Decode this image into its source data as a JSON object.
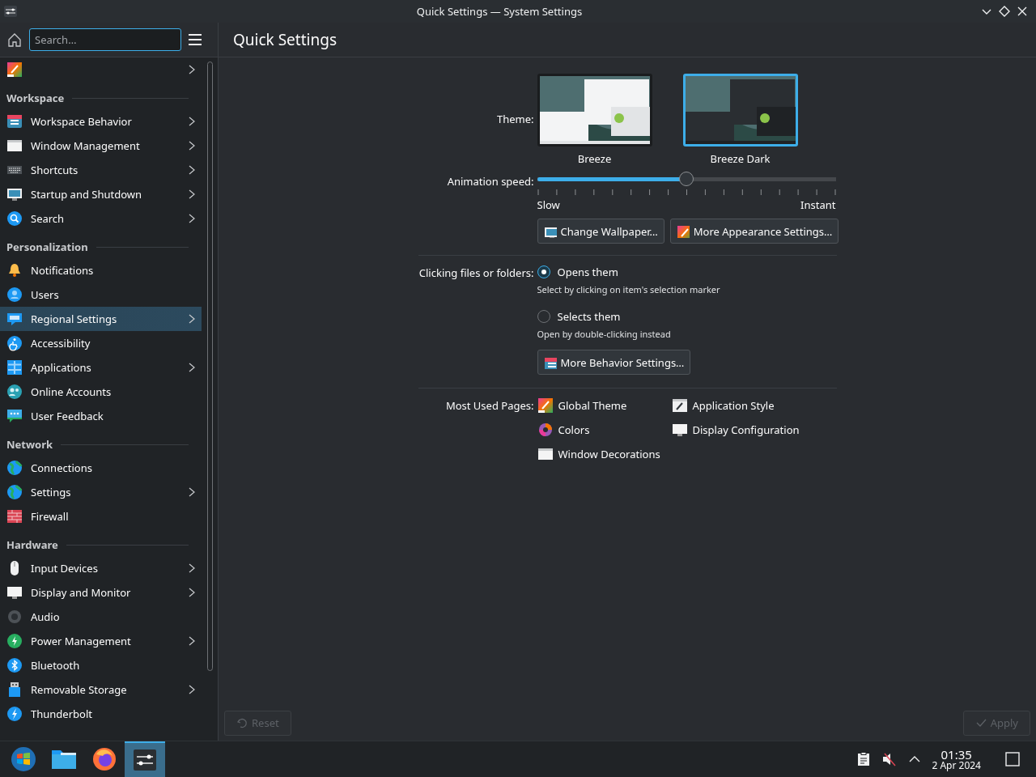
{
  "window": {
    "title": "Quick Settings — System Settings"
  },
  "search": {
    "placeholder": "Search…"
  },
  "page_title": "Quick Settings",
  "sidebar": {
    "top_item": {
      "has_children": true,
      "selected": false
    },
    "sections": [
      {
        "heading": "Workspace",
        "items": [
          {
            "label": "Workspace Behavior",
            "has_children": true,
            "selected": false
          },
          {
            "label": "Window Management",
            "has_children": true,
            "selected": false
          },
          {
            "label": "Shortcuts",
            "has_children": true,
            "selected": false
          },
          {
            "label": "Startup and Shutdown",
            "has_children": true,
            "selected": false
          },
          {
            "label": "Search",
            "has_children": true,
            "selected": false
          }
        ]
      },
      {
        "heading": "Personalization",
        "items": [
          {
            "label": "Notifications",
            "has_children": false,
            "selected": false
          },
          {
            "label": "Users",
            "has_children": false,
            "selected": false
          },
          {
            "label": "Regional Settings",
            "has_children": true,
            "selected": true
          },
          {
            "label": "Accessibility",
            "has_children": false,
            "selected": false
          },
          {
            "label": "Applications",
            "has_children": true,
            "selected": false
          },
          {
            "label": "Online Accounts",
            "has_children": false,
            "selected": false
          },
          {
            "label": "User Feedback",
            "has_children": false,
            "selected": false
          }
        ]
      },
      {
        "heading": "Network",
        "items": [
          {
            "label": "Connections",
            "has_children": false,
            "selected": false
          },
          {
            "label": "Settings",
            "has_children": true,
            "selected": false
          },
          {
            "label": "Firewall",
            "has_children": false,
            "selected": false
          }
        ]
      },
      {
        "heading": "Hardware",
        "items": [
          {
            "label": "Input Devices",
            "has_children": true,
            "selected": false
          },
          {
            "label": "Display and Monitor",
            "has_children": true,
            "selected": false
          },
          {
            "label": "Audio",
            "has_children": false,
            "selected": false
          },
          {
            "label": "Power Management",
            "has_children": true,
            "selected": false
          },
          {
            "label": "Bluetooth",
            "has_children": false,
            "selected": false
          },
          {
            "label": "Removable Storage",
            "has_children": true,
            "selected": false
          },
          {
            "label": "Thunderbolt",
            "has_children": false,
            "selected": false
          }
        ]
      }
    ]
  },
  "theme": {
    "label": "Theme:",
    "options": [
      {
        "name": "Breeze",
        "kind": "light",
        "selected": false
      },
      {
        "name": "Breeze Dark",
        "kind": "dark",
        "selected": true
      }
    ]
  },
  "animation_speed": {
    "label": "Animation speed:",
    "level": 0.5,
    "min_label": "Slow",
    "max_label": "Instant"
  },
  "appearance_buttons": [
    "Change Wallpaper…",
    "More Appearance Settings…"
  ],
  "clicking": {
    "label": "Clicking files or folders:",
    "options": [
      {
        "label": "Opens them",
        "hint": "Select by clicking on item's selection marker",
        "selected": true
      },
      {
        "label": "Selects them",
        "hint": "Open by double-clicking instead",
        "selected": false
      }
    ],
    "button": "More Behavior Settings…"
  },
  "most_used": {
    "label": "Most Used Pages:",
    "pages": [
      "Global Theme",
      "Application Style",
      "Colors",
      "Display Configuration",
      "Window Decorations"
    ]
  },
  "footer": {
    "reset": {
      "label": "Reset",
      "disabled": true
    },
    "apply": {
      "label": "Apply",
      "disabled": true
    }
  },
  "taskbar": {
    "tasks": [
      {
        "selected": false
      },
      {
        "selected": false
      },
      {
        "selected": false
      },
      {
        "selected": true
      }
    ],
    "volume": {
      "muted": true
    },
    "clock": {
      "time": "01:35",
      "date": "2 Apr 2024"
    }
  }
}
